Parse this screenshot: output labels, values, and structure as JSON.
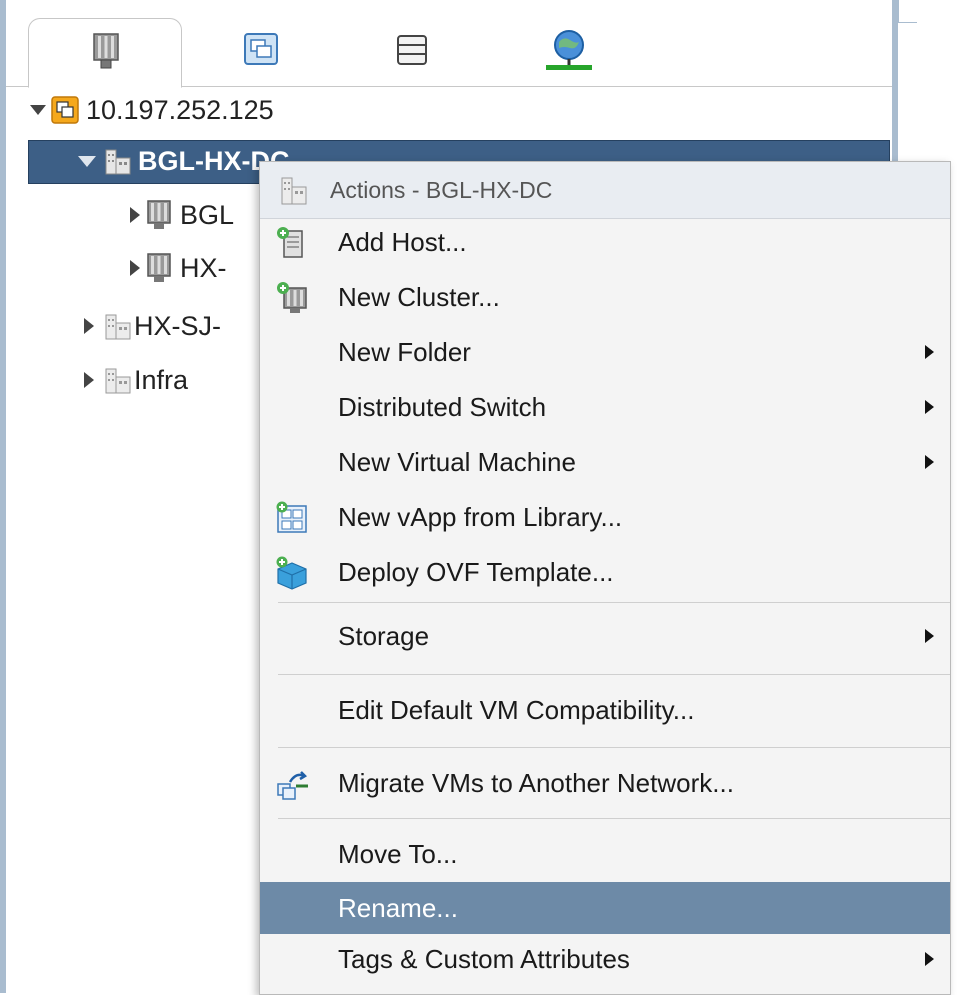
{
  "tabs": [
    {
      "name": "hosts-and-clusters-icon"
    },
    {
      "name": "vms-and-templates-icon"
    },
    {
      "name": "storage-icon"
    },
    {
      "name": "networking-icon"
    }
  ],
  "tree": {
    "root": "10.197.252.125",
    "datacenter_selected": "BGL-HX-DC",
    "child1": "BGL",
    "child2": "HX-",
    "dc2": "HX-SJ-",
    "dc3": "Infra"
  },
  "menu": {
    "header": "Actions - BGL-HX-DC",
    "items": [
      {
        "label": "Add Host...",
        "icon": "add-host-icon",
        "submenu": false
      },
      {
        "label": "New Cluster...",
        "icon": "new-cluster-icon",
        "submenu": false
      },
      {
        "label": "New Folder",
        "icon": "",
        "submenu": true
      },
      {
        "label": "Distributed Switch",
        "icon": "",
        "submenu": true
      },
      {
        "label": "New Virtual Machine",
        "icon": "",
        "submenu": true
      },
      {
        "label": "New vApp from Library...",
        "icon": "new-vapp-icon",
        "submenu": false
      },
      {
        "label": "Deploy OVF Template...",
        "icon": "deploy-ovf-icon",
        "submenu": false
      },
      {
        "label": "Storage",
        "icon": "",
        "submenu": true
      },
      {
        "label": "Edit Default VM Compatibility...",
        "icon": "",
        "submenu": false
      },
      {
        "label": "Migrate VMs to Another Network...",
        "icon": "migrate-vms-icon",
        "submenu": false
      },
      {
        "label": "Move To...",
        "icon": "",
        "submenu": false
      },
      {
        "label": "Rename...",
        "icon": "",
        "submenu": false
      },
      {
        "label": "Tags & Custom Attributes",
        "icon": "",
        "submenu": true
      }
    ]
  }
}
